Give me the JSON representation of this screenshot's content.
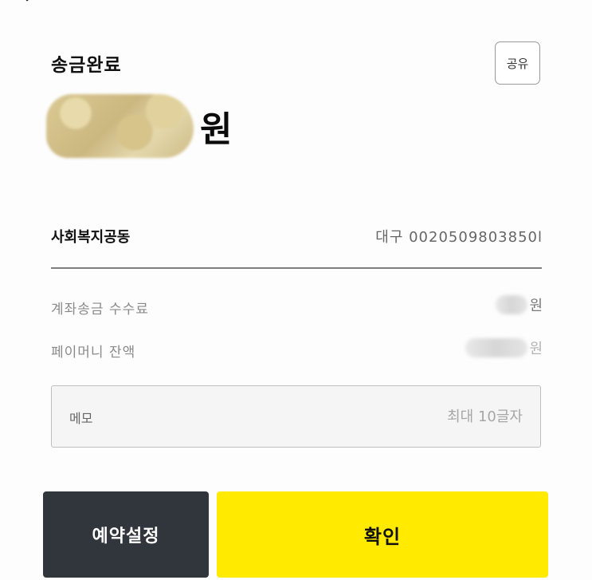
{
  "header": {
    "title": "송금완료",
    "share_label": "공유"
  },
  "amount": {
    "unit": "원"
  },
  "recipient": {
    "name": "사회복지공동",
    "account": "대구 0020509803850l"
  },
  "details": [
    {
      "label": "계좌송금 수수료",
      "value_unit": "원"
    },
    {
      "label": "페이머니 잔액",
      "value_unit": "원"
    }
  ],
  "memo": {
    "label": "메모",
    "placeholder": "최대 10글자",
    "value": ""
  },
  "actions": {
    "schedule_label": "예약설정",
    "confirm_label": "확인"
  },
  "colors": {
    "confirm_bg": "#ffea00",
    "schedule_bg": "#31363d",
    "divider": "#7f7f7f"
  },
  "icons": {
    "back": "back-arrow-icon"
  }
}
